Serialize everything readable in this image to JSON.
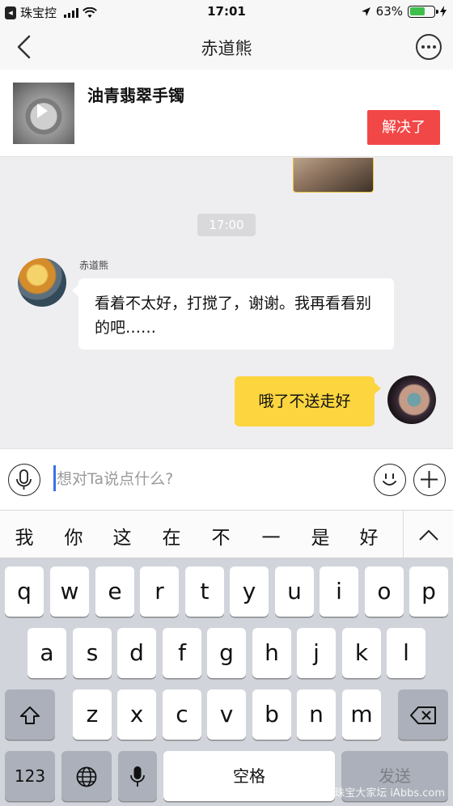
{
  "status_bar": {
    "back_app": "珠宝控",
    "time": "17:01",
    "battery": "63%",
    "battery_level": 0.63
  },
  "nav": {
    "title": "赤道熊"
  },
  "product": {
    "title": "油青翡翠手镯",
    "solve_label": "解决了"
  },
  "chat": {
    "time_label": "17:00",
    "incoming": {
      "sender": "赤道熊",
      "text": "看着不太好，打搅了，谢谢。我再看看别的吧……"
    },
    "outgoing": {
      "text": "哦了不送走好"
    }
  },
  "input": {
    "placeholder": "想对Ta说点什么?"
  },
  "candidates": [
    "我",
    "你",
    "这",
    "在",
    "不",
    "一",
    "是",
    "好"
  ],
  "keyboard": {
    "row1": [
      "q",
      "w",
      "e",
      "r",
      "t",
      "y",
      "u",
      "i",
      "o",
      "p"
    ],
    "row2": [
      "a",
      "s",
      "d",
      "f",
      "g",
      "h",
      "j",
      "k",
      "l"
    ],
    "row3": [
      "z",
      "x",
      "c",
      "v",
      "b",
      "n",
      "m"
    ],
    "numbers_label": "123",
    "space_label": "空格",
    "send_label": "发送"
  },
  "watermark": "珠宝大家坛 iAbbs.com",
  "colors": {
    "accent_red": "#f24747",
    "bubble_yellow": "#fcd53f",
    "caret_blue": "#3b6fe8"
  }
}
